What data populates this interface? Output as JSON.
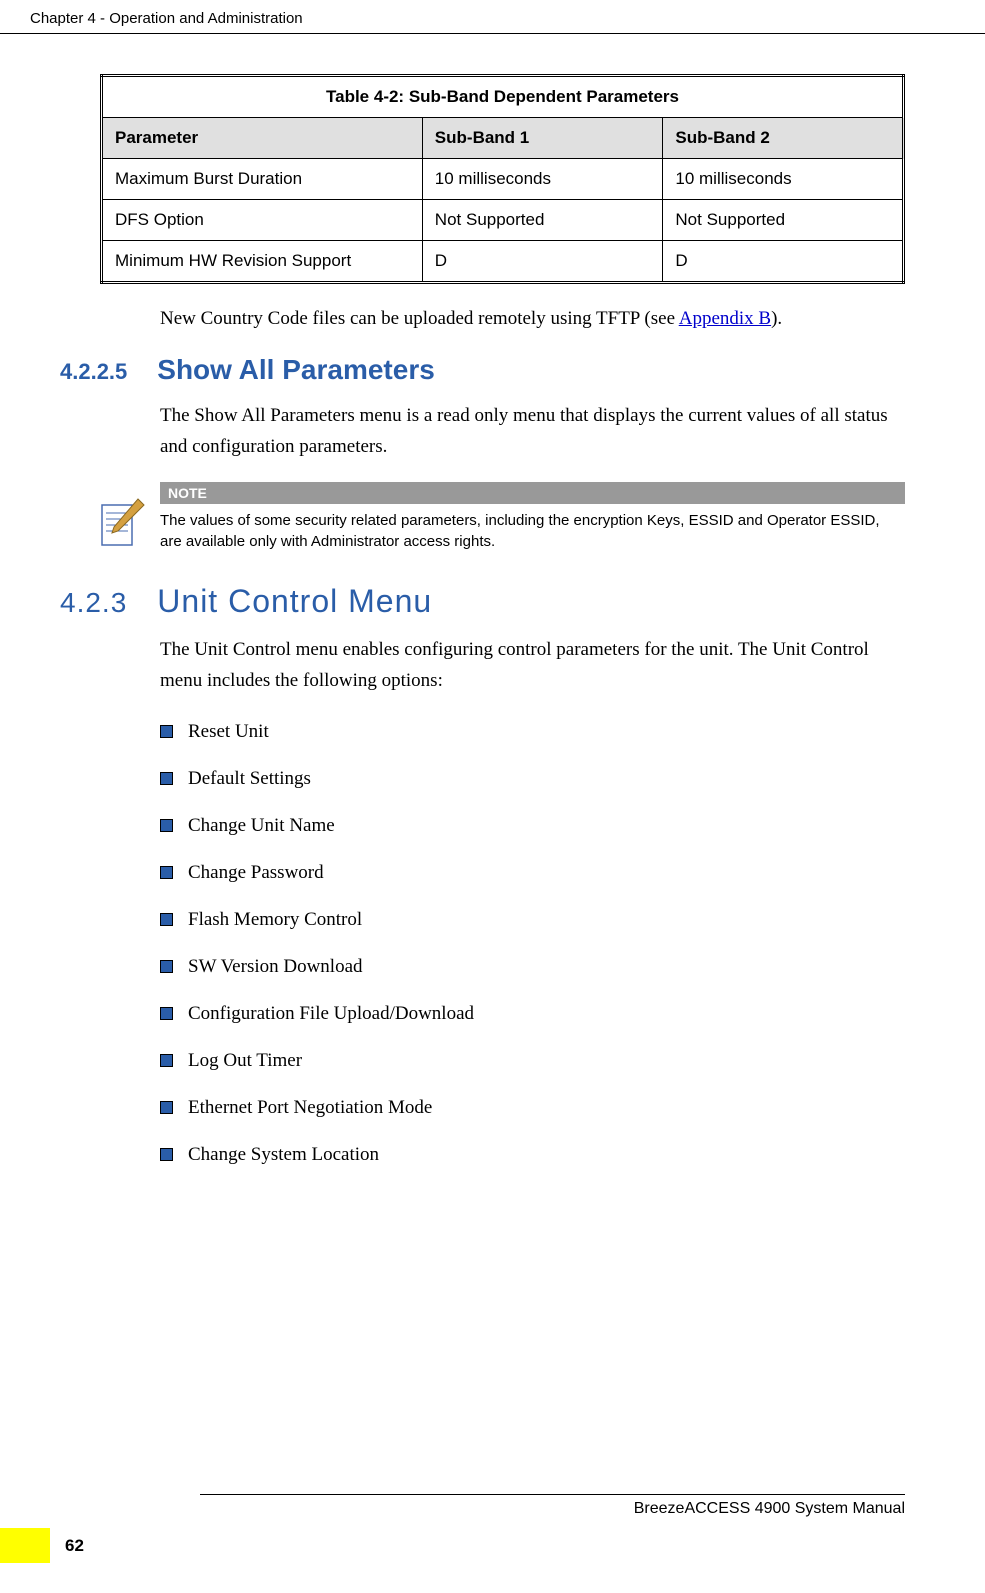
{
  "header": {
    "chapter": "Chapter 4 - Operation and Administration"
  },
  "table": {
    "title": "Table 4-2: Sub-Band Dependent Parameters",
    "headers": [
      "Parameter",
      "Sub-Band 1",
      "Sub-Band 2"
    ],
    "rows": [
      [
        "Maximum Burst Duration",
        "10 milliseconds",
        "10 milliseconds"
      ],
      [
        "DFS Option",
        "Not Supported",
        "Not Supported"
      ],
      [
        "Minimum HW Revision Support",
        "D",
        "D"
      ]
    ]
  },
  "text1": {
    "before_link": "New Country Code files can be uploaded remotely using TFTP (see ",
    "link": "Appendix B",
    "after_link": ")."
  },
  "section_4225": {
    "num": "4.2.2.5",
    "title": "Show All Parameters",
    "body": "The Show All Parameters menu is a read only menu that displays the current values of all status and configuration parameters."
  },
  "note": {
    "label": "NOTE",
    "text": "The values of some security related parameters, including the encryption Keys, ESSID and Operator ESSID, are available only with Administrator access rights."
  },
  "section_423": {
    "num": "4.2.3",
    "title": "Unit Control Menu",
    "body": "The Unit Control menu enables configuring control parameters for the unit. The Unit Control menu includes the following options:"
  },
  "bullets": [
    "Reset Unit",
    "Default Settings",
    "Change Unit Name",
    "Change Password",
    "Flash Memory Control",
    "SW Version Download",
    "Configuration File Upload/Download",
    "Log Out Timer",
    "Ethernet Port Negotiation Mode",
    "Change System Location"
  ],
  "footer": {
    "title": "BreezeACCESS 4900 System Manual",
    "page": "62"
  }
}
